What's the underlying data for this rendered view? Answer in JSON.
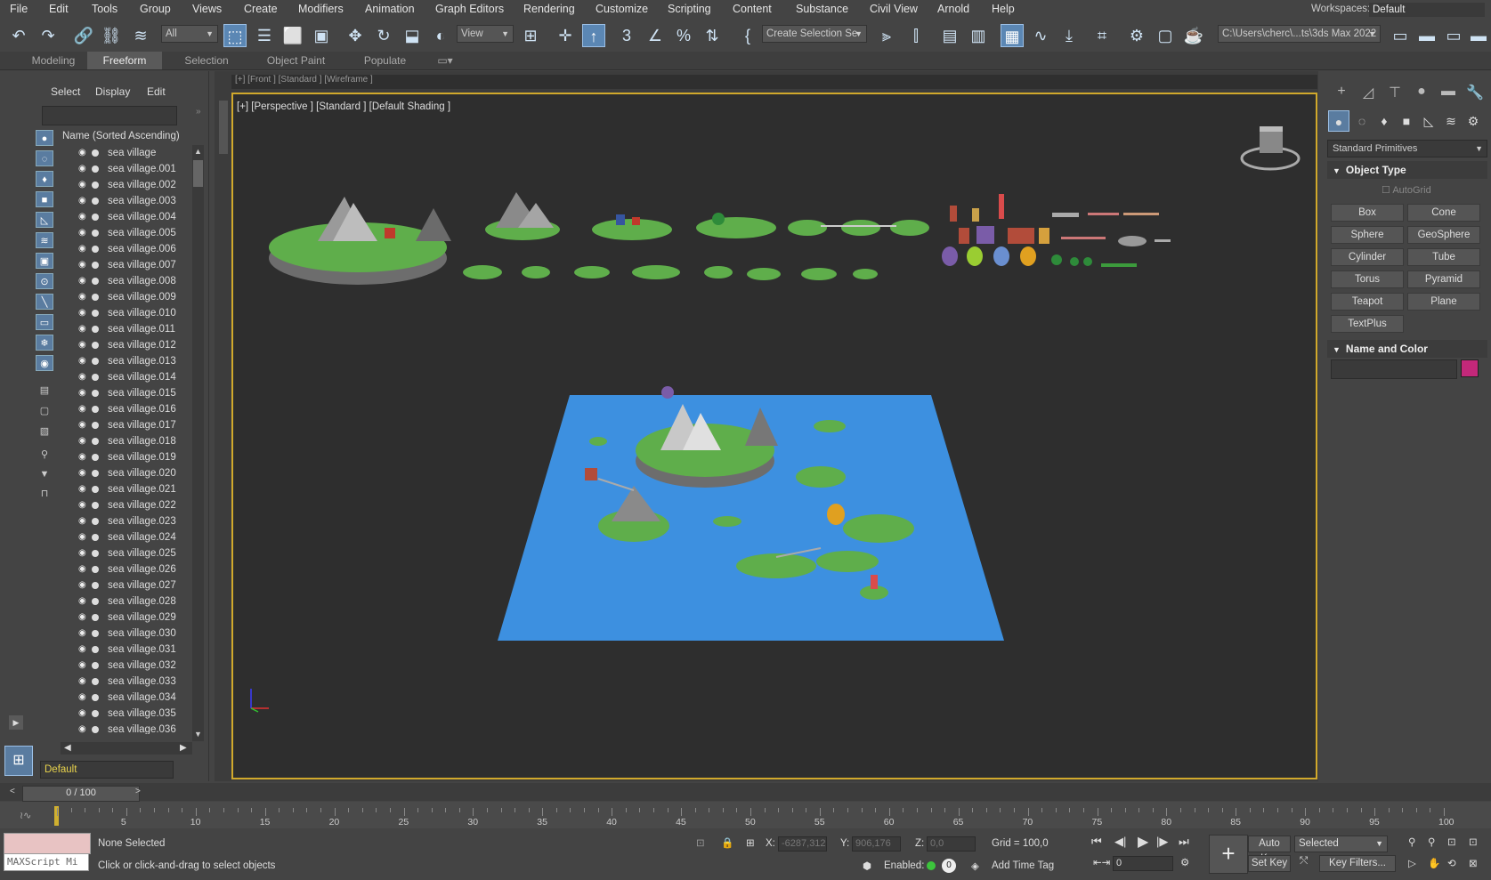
{
  "menu": [
    "File",
    "Edit",
    "Tools",
    "Group",
    "Views",
    "Create",
    "Modifiers",
    "Animation",
    "Graph Editors",
    "Rendering",
    "Customize",
    "Scripting",
    "Content",
    "Substance",
    "Civil View",
    "Arnold",
    "Help"
  ],
  "workspace": {
    "label": "Workspaces:",
    "value": "Default"
  },
  "toolbar": {
    "filter_all": "All",
    "ref_coord": "View",
    "create_selection": "Create Selection Se",
    "path": "C:\\Users\\cherc\\...ts\\3ds Max 2022"
  },
  "ribbon_tabs": [
    "Modeling",
    "Freeform",
    "Selection",
    "Object Paint",
    "Populate"
  ],
  "explorer": {
    "menu": [
      "Select",
      "Display",
      "Edit"
    ],
    "column_header": "Name (Sorted Ascending)",
    "items": [
      "sea village",
      "sea village.001",
      "sea village.002",
      "sea village.003",
      "sea village.004",
      "sea village.005",
      "sea village.006",
      "sea village.007",
      "sea village.008",
      "sea village.009",
      "sea village.010",
      "sea village.011",
      "sea village.012",
      "sea village.013",
      "sea village.014",
      "sea village.015",
      "sea village.016",
      "sea village.017",
      "sea village.018",
      "sea village.019",
      "sea village.020",
      "sea village.021",
      "sea village.022",
      "sea village.023",
      "sea village.024",
      "sea village.025",
      "sea village.026",
      "sea village.027",
      "sea village.028",
      "sea village.029",
      "sea village.030",
      "sea village.031",
      "sea village.032",
      "sea village.033",
      "sea village.034",
      "sea village.035",
      "sea village.036"
    ],
    "layer": "Default"
  },
  "viewport": {
    "top_label": "[+] [Front ] [Standard ] [Wireframe ]",
    "label": "[+] [Perspective ] [Standard ] [Default Shading ]",
    "water_color": "#3d90e0"
  },
  "command_panel": {
    "category": "Standard Primitives",
    "object_type_title": "Object Type",
    "autogrid": "AutoGrid",
    "buttons": [
      "Box",
      "Cone",
      "Sphere",
      "GeoSphere",
      "Cylinder",
      "Tube",
      "Torus",
      "Pyramid",
      "Teapot",
      "Plane",
      "TextPlus"
    ],
    "name_color_title": "Name and Color",
    "swatch_color": "#c4287a"
  },
  "timeline": {
    "frame_display": "0 / 100",
    "ticks": [
      "5",
      "10",
      "15",
      "20",
      "25",
      "30",
      "35",
      "40",
      "45",
      "50",
      "55",
      "60",
      "65",
      "70",
      "75",
      "80",
      "85",
      "90",
      "95",
      "100"
    ]
  },
  "status": {
    "maxscript": "MAXScript Mi",
    "selection": "None Selected",
    "prompt": "Click or click-and-drag to select objects",
    "x_label": "X:",
    "x_value": "-6287,312",
    "y_label": "Y:",
    "y_value": "906,176",
    "z_label": "Z:",
    "z_value": "0,0",
    "grid": "Grid = 100,0",
    "enabled": "Enabled:",
    "add_time_tag": "Add Time Tag",
    "auto_key": "Auto Key",
    "set_key": "Set Key",
    "selected": "Selected",
    "key_filters": "Key Filters...",
    "frame": "0"
  }
}
